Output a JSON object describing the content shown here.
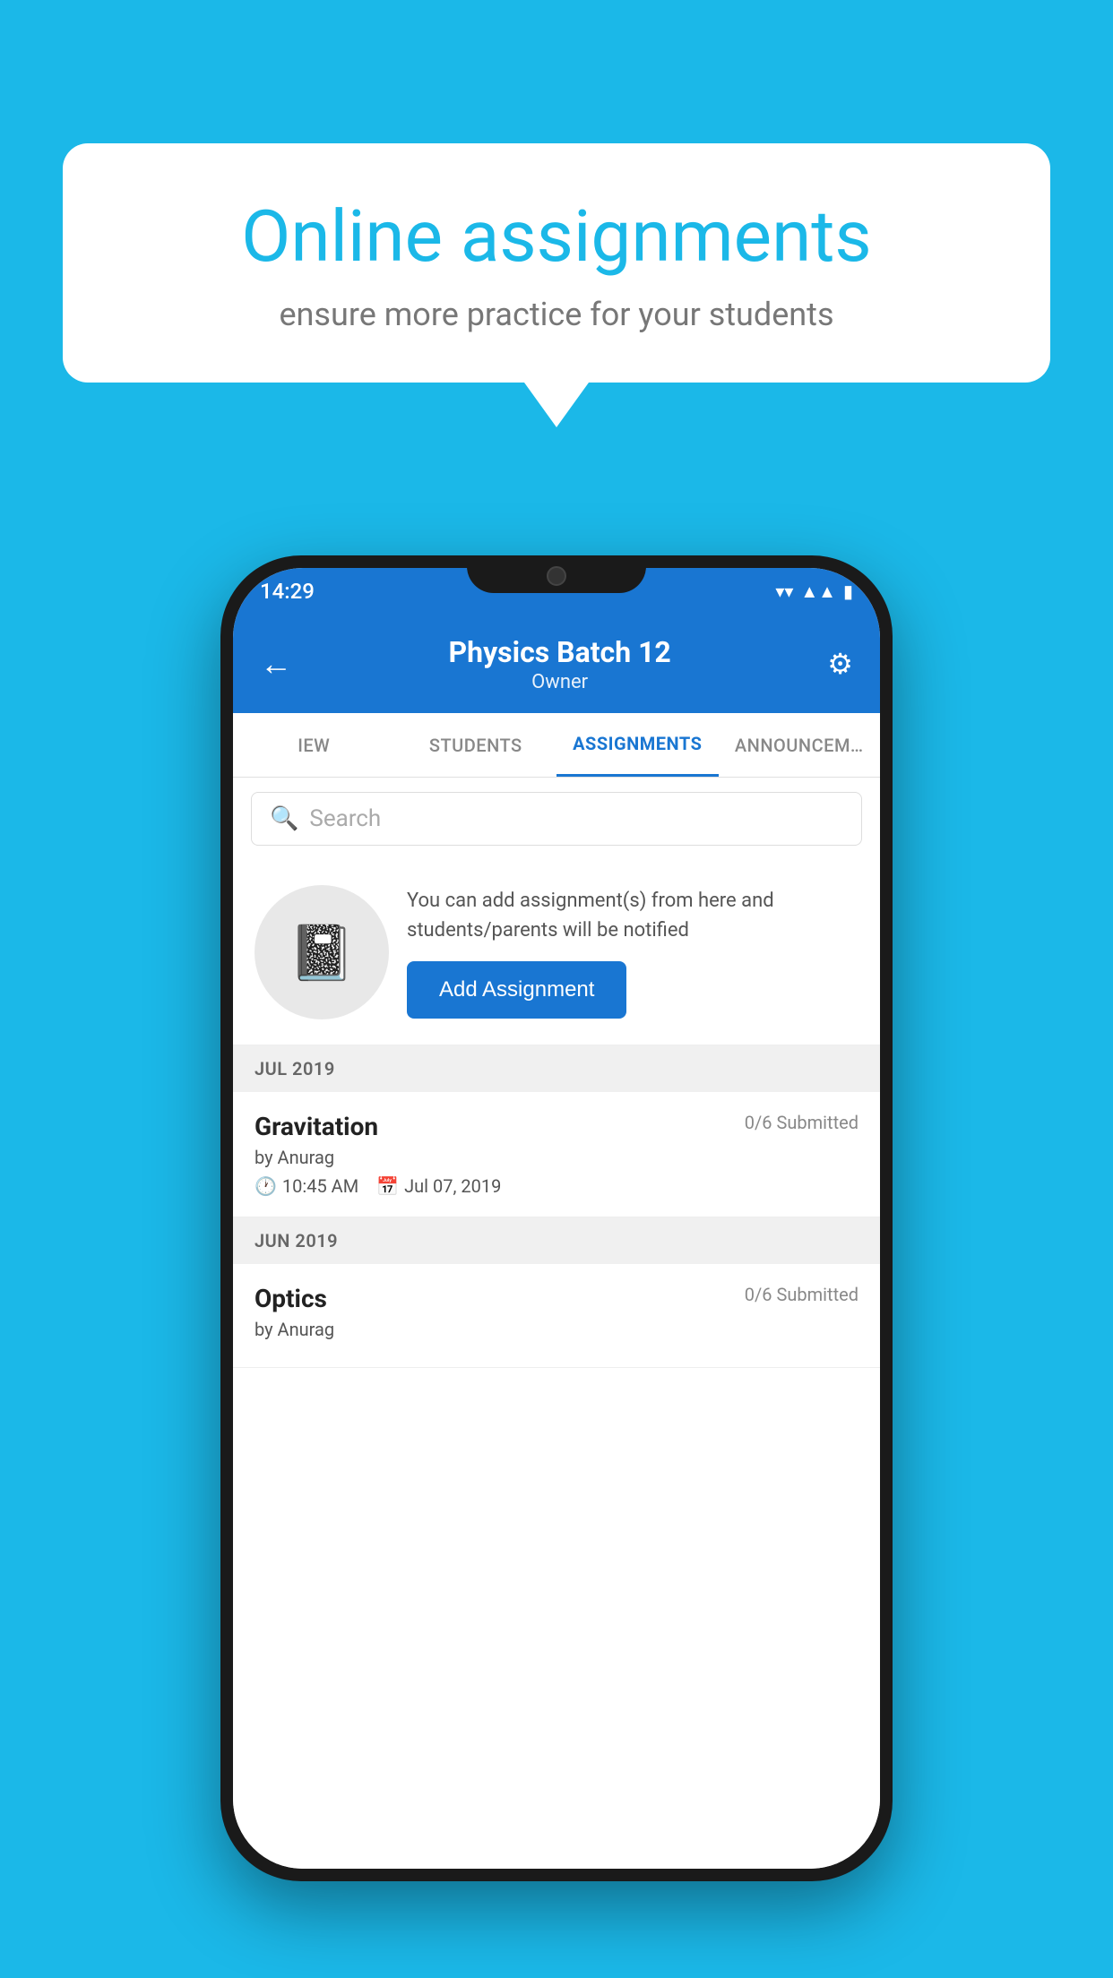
{
  "background_color": "#1BB8E8",
  "speech_bubble": {
    "title": "Online assignments",
    "subtitle": "ensure more practice for your students"
  },
  "status_bar": {
    "time": "14:29",
    "wifi_icon": "▾",
    "signal_icon": "▲",
    "battery_icon": "▮"
  },
  "app_header": {
    "back_icon": "←",
    "title": "Physics Batch 12",
    "subtitle": "Owner",
    "settings_icon": "⚙"
  },
  "tabs": [
    {
      "label": "IEW",
      "active": false
    },
    {
      "label": "STUDENTS",
      "active": false
    },
    {
      "label": "ASSIGNMENTS",
      "active": true
    },
    {
      "label": "ANNOUNCEM…",
      "active": false
    }
  ],
  "search": {
    "placeholder": "Search",
    "icon": "🔍"
  },
  "promo": {
    "description": "You can add assignment(s) from here and students/parents will be notified",
    "add_button_label": "Add Assignment",
    "icon": "📓"
  },
  "sections": [
    {
      "month_label": "JUL 2019",
      "assignments": [
        {
          "title": "Gravitation",
          "submitted": "0/6 Submitted",
          "by": "by Anurag",
          "time": "10:45 AM",
          "date": "Jul 07, 2019"
        }
      ]
    },
    {
      "month_label": "JUN 2019",
      "assignments": [
        {
          "title": "Optics",
          "submitted": "0/6 Submitted",
          "by": "by Anurag",
          "time": "",
          "date": ""
        }
      ]
    }
  ]
}
